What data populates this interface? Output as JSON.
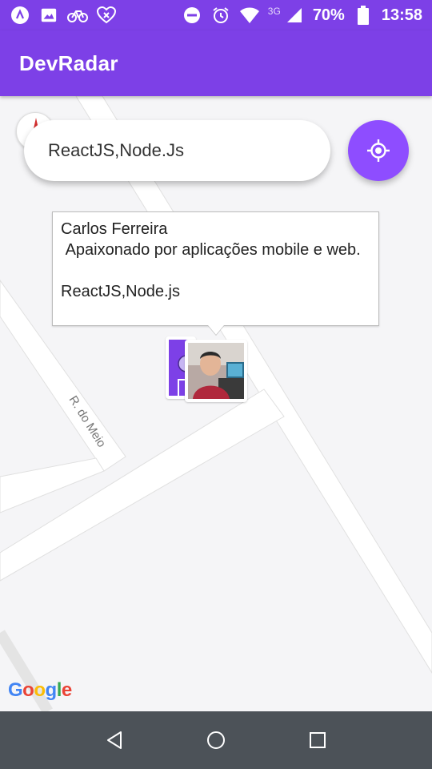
{
  "status_bar": {
    "network_label": "3G",
    "battery_percent": "70%",
    "time": "13:58",
    "icons": [
      "app-icon",
      "image-icon",
      "bike-icon",
      "heart-icon",
      "dnd-icon",
      "alarm-icon",
      "wifi-icon",
      "signal-icon",
      "battery-icon"
    ]
  },
  "app_bar": {
    "title": "DevRadar"
  },
  "search": {
    "value": "ReactJS,Node.Js"
  },
  "map": {
    "street_label": "R. do Meio",
    "google_logo": [
      "G",
      "o",
      "o",
      "g",
      "l",
      "e"
    ],
    "google_colors": [
      "#4285F4",
      "#EA4335",
      "#FBBC05",
      "#4285F4",
      "#34A853",
      "#EA4335"
    ]
  },
  "callout": {
    "name": "Carlos Ferreira",
    "bio": " Apaixonado por aplicações mobile e web.",
    "techs": "ReactJS,Node.js"
  },
  "colors": {
    "primary": "#7D40E7",
    "accent_button": "#8E4DFF",
    "nav_bar": "#4C5258"
  }
}
